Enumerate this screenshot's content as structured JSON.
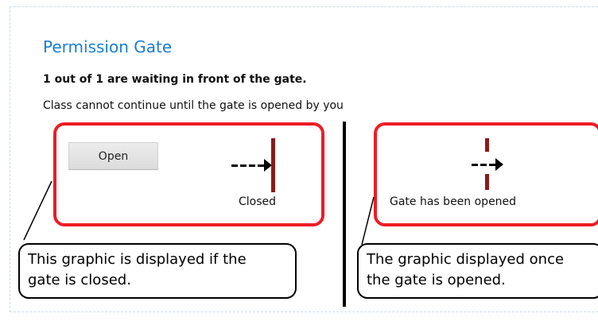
{
  "page": {
    "title": "Permission Gate",
    "waiting_text": "1 out of 1 are waiting in front of the gate.",
    "instruction_text": "Class cannot continue until the gate is opened by you"
  },
  "closed_state": {
    "button_label": "Open",
    "status_label": "Closed"
  },
  "opened_state": {
    "status_label": "Gate has been opened"
  },
  "callouts": {
    "closed": "This graphic is displayed if the\ngate is closed.",
    "opened": "The graphic displayed once\nthe gate is opened."
  },
  "colors": {
    "title": "#1a7fcf",
    "highlight_border": "#ee1c25",
    "gate_bar": "#8b1a1a"
  }
}
